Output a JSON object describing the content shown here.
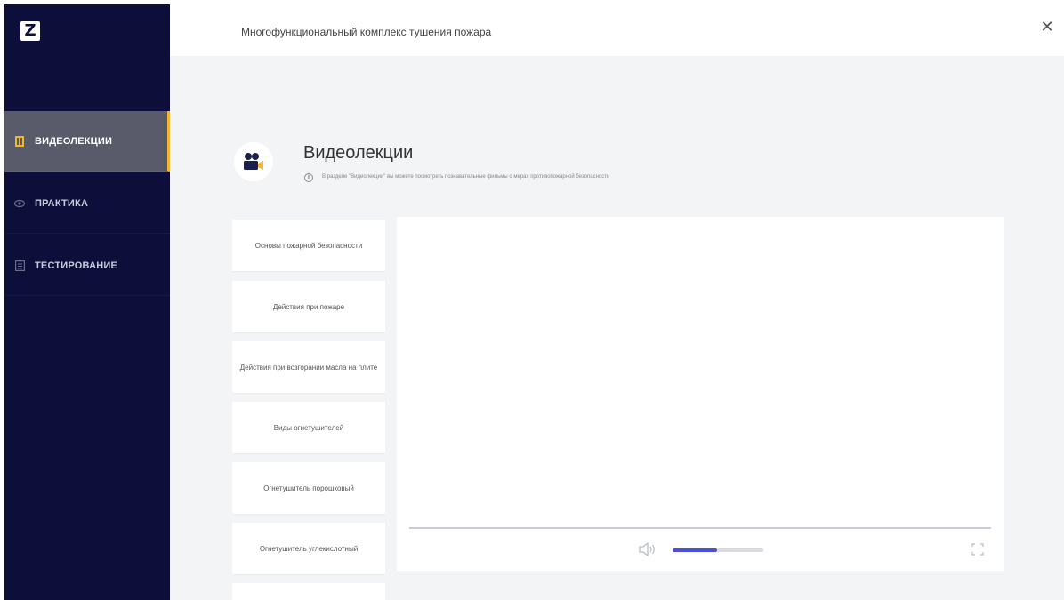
{
  "app": {
    "logo_letter": "Z",
    "title": "Многофункциональный комплекс тушения пожара",
    "close_icon": "close-icon"
  },
  "sidebar": {
    "items": [
      {
        "label": "ВИДЕОЛЕКЦИИ",
        "icon": "video-lectures-icon",
        "active": true
      },
      {
        "label": "ПРАКТИКА",
        "icon": "practice-icon",
        "active": false
      },
      {
        "label": "ТЕСТИРОВАНИЕ",
        "icon": "testing-icon",
        "active": false
      }
    ]
  },
  "section": {
    "icon": "video-camera-icon",
    "title": "Видеолекции",
    "info_icon": "info-icon",
    "description": "В разделе \"Видеолекции\" вы можете посмотреть познавательные фильмы о мерах противопожарной безопасности"
  },
  "lessons": [
    "Основы пожарной безопасности",
    "Действия при пожаре",
    "Действия при возгорании масла на плите",
    "Виды огнетушителей",
    "Огнетушитель порошковый",
    "Огнетушитель углекислотный",
    ""
  ],
  "player": {
    "volume_level": 0.49,
    "volume_icon": "volume-icon",
    "fullscreen_icon": "fullscreen-icon"
  },
  "colors": {
    "sidebar_bg": "#0d0e3a",
    "active_item_bg": "#5a5b6a",
    "accent": "#f2b632",
    "volume_fill": "#4a50d6",
    "content_bg": "#f3f4f6"
  }
}
